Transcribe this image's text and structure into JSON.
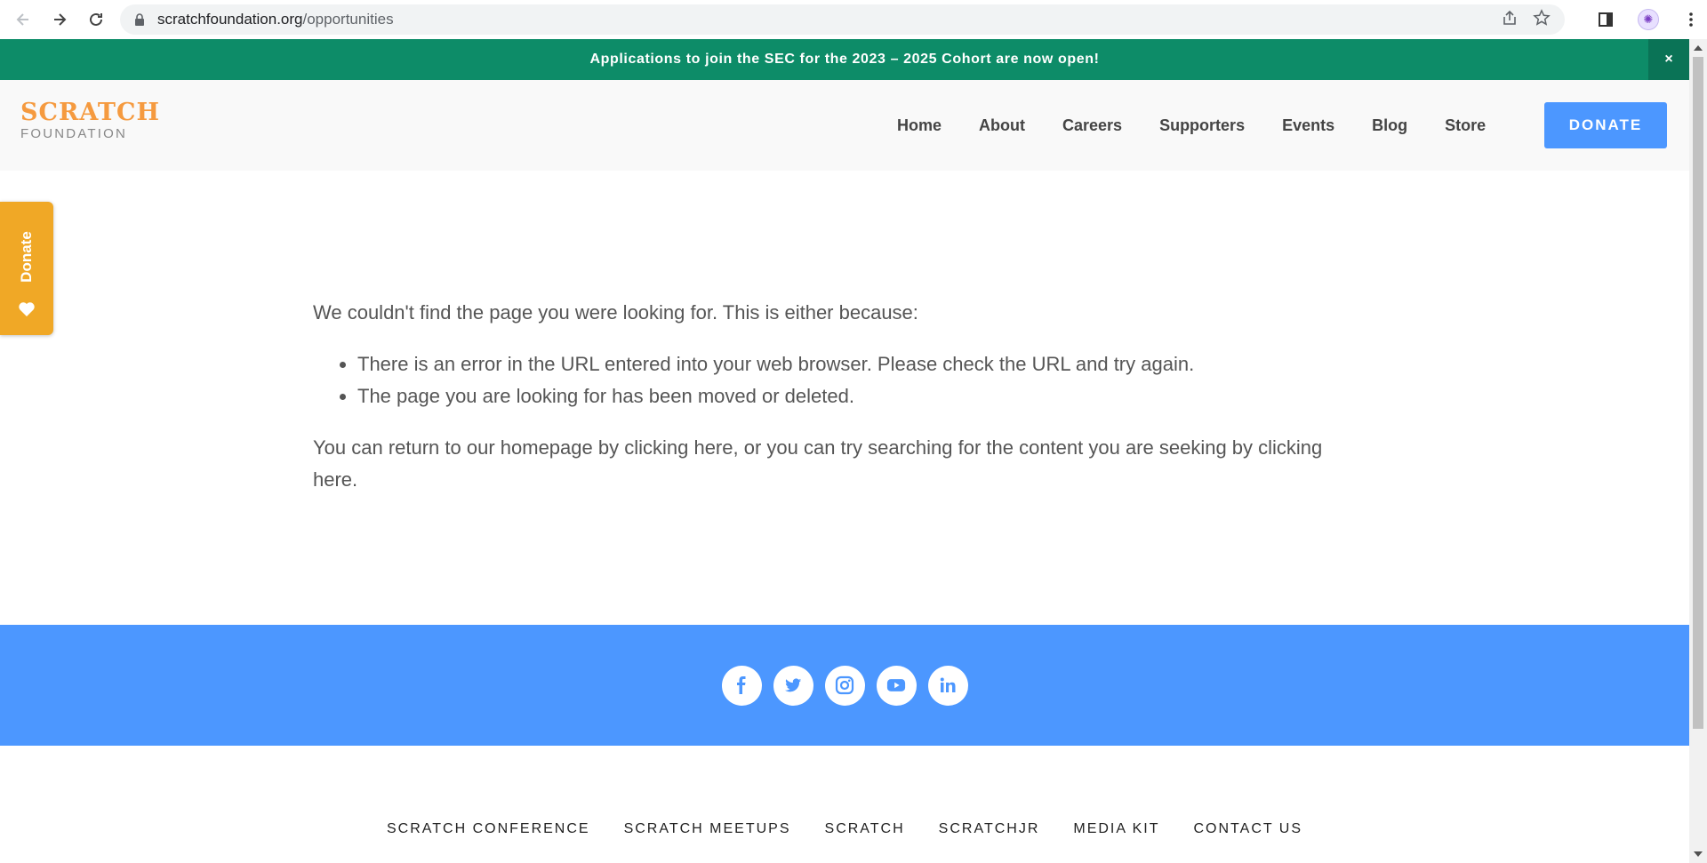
{
  "browser": {
    "url_host": "scratchfoundation.org",
    "url_path": "/opportunities"
  },
  "announcement": {
    "text": "Applications to join the SEC for the 2023 – 2025 Cohort are now open!",
    "close": "×"
  },
  "logo": {
    "line1": "SCRATCH",
    "line2": "FOUNDATION",
    "color": "#f59a3f"
  },
  "nav": {
    "items": [
      {
        "label": "Home"
      },
      {
        "label": "About"
      },
      {
        "label": "Careers"
      },
      {
        "label": "Supporters"
      },
      {
        "label": "Events"
      },
      {
        "label": "Blog"
      },
      {
        "label": "Store"
      }
    ],
    "donate": "DONATE"
  },
  "side_donate": {
    "label": "Donate",
    "color": "#f0a826"
  },
  "content": {
    "intro": "We couldn't find the page you were looking for. This is either because:",
    "reasons": [
      "There is an error in the URL entered into your web browser. Please check the URL and try again.",
      "The page you are looking for has been moved or deleted."
    ],
    "outro": "You can return to our homepage by clicking here, or you can try searching for the content you are seeking by clicking here."
  },
  "social": [
    "facebook-icon",
    "twitter-icon",
    "instagram-icon",
    "youtube-icon",
    "linkedin-icon"
  ],
  "footer_links": [
    {
      "label": "SCRATCH CONFERENCE"
    },
    {
      "label": "SCRATCH MEETUPS"
    },
    {
      "label": "SCRATCH"
    },
    {
      "label": "SCRATCHJR"
    },
    {
      "label": "MEDIA KIT"
    },
    {
      "label": "CONTACT US"
    }
  ],
  "colors": {
    "announcement_bg": "#0d8c68",
    "footer_blue": "#4c97ff",
    "donate_button": "#4c97ff"
  }
}
